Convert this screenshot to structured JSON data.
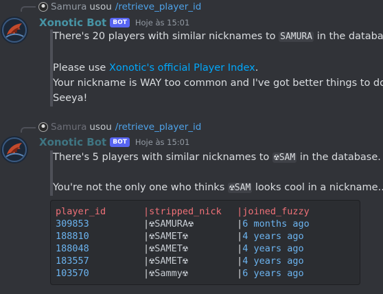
{
  "message1": {
    "reply": {
      "username": "Samura",
      "used": "usou",
      "command": "/retrieve_player_id"
    },
    "author": "Xonotic Bot",
    "tag": "BOT",
    "timestamp": "Hoje às 15:01",
    "text_line1_pre": "There's 20 players with similar nicknames to",
    "text_line1_code": "SAMURA",
    "text_line1_post": "in the database.",
    "text_line2_pre": "Please use",
    "text_line2_link": "Xonotic's official Player Index",
    "text_line2_post": ".",
    "text_line3": "Your nickname is WAY too common and I've got better things to do!",
    "text_line4": "Seeya!"
  },
  "message2": {
    "reply": {
      "username": "Samura",
      "used": "usou",
      "command": "/retrieve_player_id"
    },
    "author": "Xonotic Bot",
    "tag": "BOT",
    "timestamp": "Hoje às 15:01",
    "text_line1_pre": "There's 5 players with similar nicknames to",
    "text_line1_code": "☢SAM",
    "text_line1_post": "in the database.",
    "text_line2_pre": "You're not the only one who thinks",
    "text_line2_code": "☢SAM",
    "text_line2_post": "looks cool in a nickname...",
    "table": {
      "headers": [
        "player_id",
        "stripped_nick",
        "joined_fuzzy"
      ],
      "rows": [
        [
          "309853",
          "☢SAMURA☢",
          "6 months ago"
        ],
        [
          "188810",
          "☢SAMET☢",
          "4 years ago"
        ],
        [
          "188048",
          "☢SAMET☢",
          "4 years ago"
        ],
        [
          "183557",
          "☢SAMET☢",
          "4 years ago"
        ],
        [
          "103570",
          "☢Sammy☢",
          "6 years ago"
        ]
      ]
    }
  },
  "colors": {
    "background": "#313338",
    "bot_name": "#4794a5",
    "bot_tag": "#5865f2",
    "link": "#00a8fc",
    "command": "#4ea2e8",
    "code_header": "#f07178",
    "code_value": "#6cb4f0"
  },
  "icons": {
    "avatar": "xonotic-logo-icon",
    "mini_avatar": "user-avatar-icon"
  }
}
